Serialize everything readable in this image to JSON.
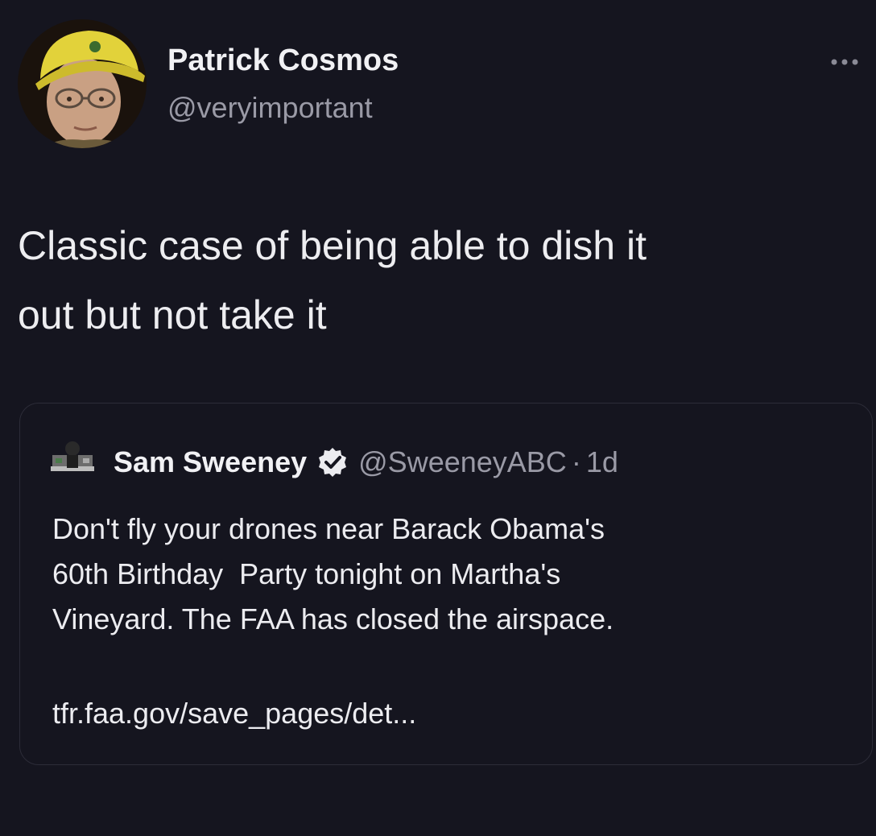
{
  "tweet": {
    "display_name": "Patrick Cosmos",
    "handle": "@veryimportant",
    "text_line1": "Classic case of being able to dish it",
    "text_line2": "out but not take it",
    "more_icon": "more-horizontal-icon"
  },
  "quoted_tweet": {
    "display_name": "Sam Sweeney",
    "verified_icon": "verified-badge-icon",
    "handle": "@SweeneyABC",
    "separator": "·",
    "time": "1d",
    "text_line1": "Don't fly your drones near Barack Obama's",
    "text_line2": "60th Birthday  Party tonight on Martha's",
    "text_line3": "Vineyard. The FAA has closed the airspace.",
    "link": "tfr.faa.gov/save_pages/det..."
  },
  "colors": {
    "background": "#15151f",
    "primary_text": "#ededf0",
    "secondary_text": "#9a9aa6",
    "card_border": "#2c2c38"
  }
}
